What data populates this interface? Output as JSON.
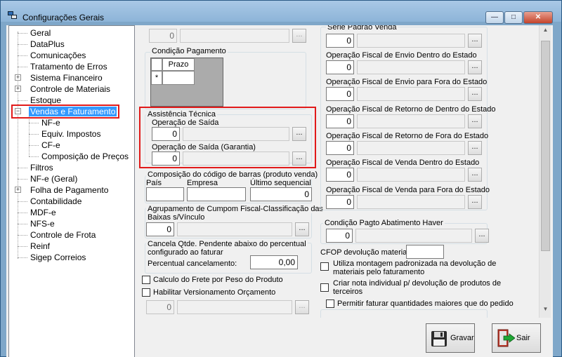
{
  "window": {
    "title": "Configurações Gerais",
    "minimize_glyph": "—",
    "maximize_glyph": "□",
    "close_glyph": "✕"
  },
  "tree": {
    "items": [
      {
        "label": "Geral"
      },
      {
        "label": "DataPlus"
      },
      {
        "label": "Comunicações"
      },
      {
        "label": "Tratamento de Erros"
      },
      {
        "label": "Sistema Financeiro"
      },
      {
        "label": "Controle de Materiais"
      },
      {
        "label": "Estoque"
      },
      {
        "label": "Vendas e Faturamento"
      },
      {
        "label": "NF-e"
      },
      {
        "label": "Equiv. Impostos"
      },
      {
        "label": "CF-e"
      },
      {
        "label": "Composição de Preços"
      },
      {
        "label": "Filtros"
      },
      {
        "label": "NF-e (Geral)"
      },
      {
        "label": "Folha de Pagamento"
      },
      {
        "label": "Contabilidade"
      },
      {
        "label": "MDF-e"
      },
      {
        "label": "NFS-e"
      },
      {
        "label": "Controle de Frota"
      },
      {
        "label": "Reinf"
      },
      {
        "label": "Sigep Correios"
      }
    ],
    "expander_plus": "+",
    "expander_minus": "−"
  },
  "left": {
    "top_partial_value": "0",
    "condicao_pagamento": {
      "label": "Condição Pagamento",
      "column": "Prazo",
      "new_row_marker": "*"
    },
    "assistencia": {
      "label": "Assistência Técnica",
      "op_saida_label": "Operação de Saída",
      "op_saida_value": "0",
      "op_garantia_label": "Operação de Saída (Garantia)",
      "op_garantia_value": "0"
    },
    "barras": {
      "label": "Composição do código de barras (produto venda)",
      "pais_label": "País",
      "empresa_label": "Empresa",
      "ultimo_label": "Último sequencial",
      "ultimo_value": "0"
    },
    "agrupamento": {
      "label_line1": "Agrupamento de Cumpom Fiscal-Classificação das",
      "label_line2": "Baixas s/Vínculo",
      "value": "0"
    },
    "cancela": {
      "label_line1": "Cancela Qtde. Pendente abaixo do percentual",
      "label_line2": "configurado ao faturar",
      "percent_label": "Percentual cancelamento:",
      "percent_value": "0,00"
    },
    "frete_label": "Calculo do Frete por Peso do Produto",
    "versionamento_label": "Habilitar Versionamento Orçamento",
    "versionamento_value": "0"
  },
  "right": {
    "serie_label": "Série Padrão Venda",
    "fields": [
      {
        "label": "Operação Fiscal de Envio Dentro do Estado",
        "value": "0"
      },
      {
        "label": "Operação Fiscal de Envio para Fora do Estado",
        "value": "0"
      },
      {
        "label": "Operação Fiscal de Retorno de Dentro do Estado",
        "value": "0"
      },
      {
        "label": "Operação Fiscal de Retorno de Fora do Estado",
        "value": "0"
      },
      {
        "label": "Operação Fiscal de Venda Dentro do Estado",
        "value": "0"
      },
      {
        "label": "Operação Fiscal de Venda para Fora do Estado",
        "value": "0"
      }
    ],
    "serie_value": "0",
    "abatimento_label": "Condição Pagto Abatimento Haver",
    "abatimento_value": "0",
    "cfop_label": "CFOP devolução materiais:",
    "montagem_line1": "Utiliza montagem padronizada na devolução de",
    "montagem_line2": "materiais pelo faturamento",
    "criar_nota_line1": "Criar nota individual p/ devolução de produtos de",
    "criar_nota_line2": "terceiros",
    "permitir_label": "Permitir faturar quantidades maiores que do pedido"
  },
  "buttons": {
    "ellipsis": "...",
    "save": "Gravar",
    "exit": "Sair"
  },
  "colors": {
    "highlight": "#3399ff",
    "annotation_red": "#e11a1a"
  }
}
